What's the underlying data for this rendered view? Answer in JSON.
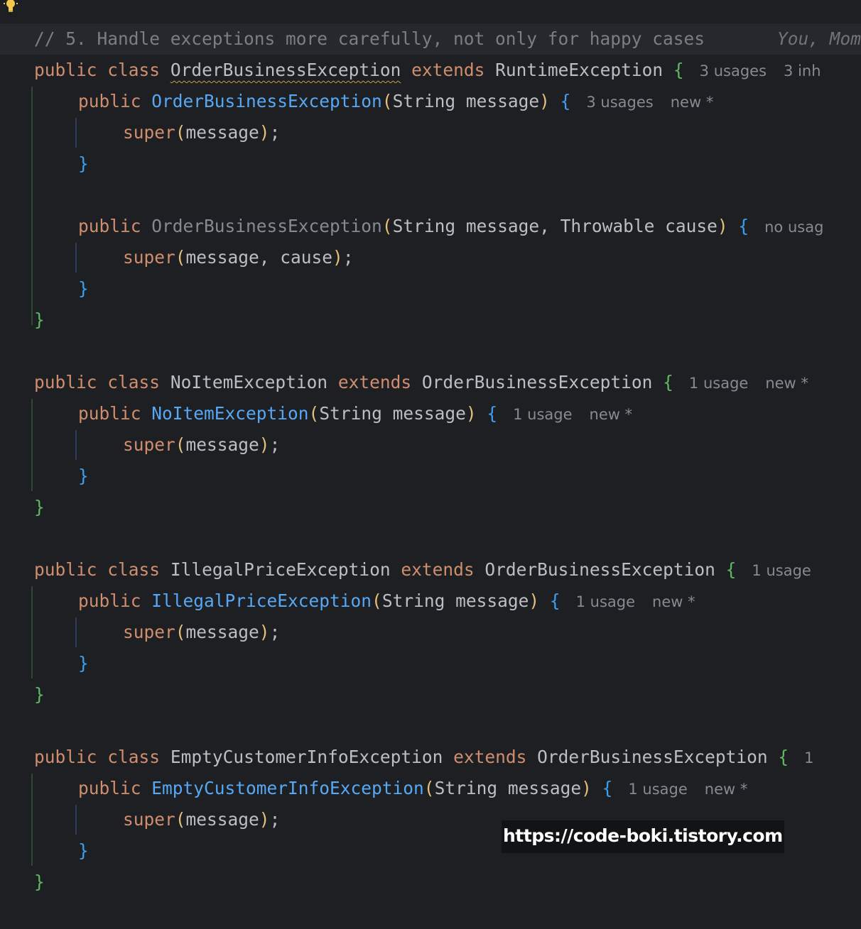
{
  "editor": {
    "comment": "// 5. Handle exceptions more carefully, not only for happy cases",
    "author_hint": "You, Mom",
    "keywords": {
      "public": "public",
      "class": "class",
      "extends": "extends",
      "super": "super"
    },
    "classes": [
      {
        "name": "OrderBusinessException",
        "parent": "RuntimeException",
        "usages": "3 usages",
        "extra_hint": "3 inh",
        "constructors": [
          {
            "name": "OrderBusinessException",
            "params": "String message",
            "usages": "3 usages",
            "badge": "new *",
            "super_args": "message"
          },
          {
            "name": "OrderBusinessException",
            "params": "String message, Throwable cause",
            "usages": "no usag",
            "badge": "",
            "super_args": "message, cause"
          }
        ]
      },
      {
        "name": "NoItemException",
        "parent": "OrderBusinessException",
        "usages": "1 usage",
        "badge": "new *",
        "constructors": [
          {
            "name": "NoItemException",
            "params": "String message",
            "usages": "1 usage",
            "badge": "new *",
            "super_args": "message"
          }
        ]
      },
      {
        "name": "IllegalPriceException",
        "parent": "OrderBusinessException",
        "usages": "1 usage",
        "constructors": [
          {
            "name": "IllegalPriceException",
            "params": "String message",
            "usages": "1 usage",
            "badge": "new *",
            "super_args": "message"
          }
        ]
      },
      {
        "name": "EmptyCustomerInfoException",
        "parent": "OrderBusinessException",
        "usages": "1",
        "constructors": [
          {
            "name": "EmptyCustomerInfoException",
            "params": "String message",
            "usages": "1 usage",
            "badge": "new *",
            "super_args": "message"
          }
        ]
      }
    ],
    "punct": {
      "open_brace": "{",
      "close_brace": "}",
      "open_paren": "(",
      "close_paren": ")",
      "semicolon": ";"
    }
  },
  "watermark": "https://code-boki.tistory.com",
  "colors": {
    "background": "#1e1f22",
    "keyword": "#cf8e6d",
    "constructor": "#56a8f5",
    "comment": "#7a7e85",
    "hint": "#868a91"
  },
  "icons": {
    "intention_bulb": "lightbulb-icon"
  }
}
